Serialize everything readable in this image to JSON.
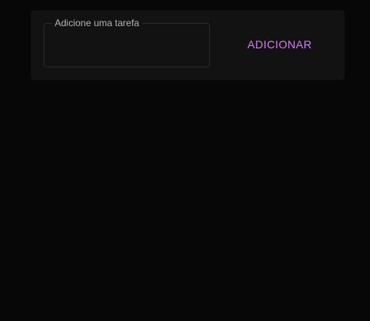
{
  "task_form": {
    "input_label": "Adicione uma tarefa",
    "input_value": "",
    "add_button_label": "ADICIONAR"
  },
  "colors": {
    "background": "#070707",
    "card": "#121212",
    "accent": "#d47cf0"
  }
}
